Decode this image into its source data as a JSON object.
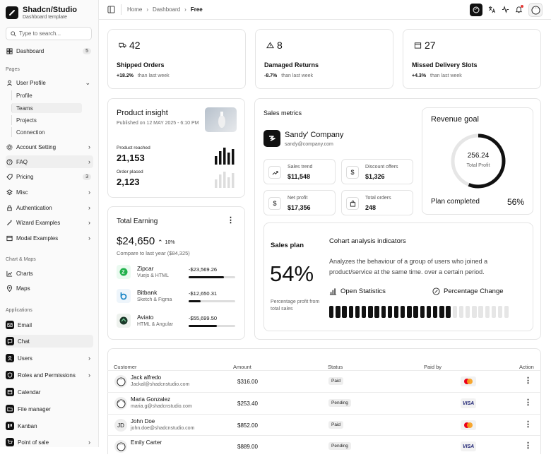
{
  "brand": {
    "title": "Shadcn/Studio",
    "subtitle": "Dashboard template"
  },
  "search": {
    "placeholder": "Type to search..."
  },
  "sidebar": {
    "dashboard": {
      "label": "Dashboard",
      "badge": "5"
    },
    "pages_section": "Pages",
    "user_profile": "User Profile",
    "sub": [
      "Profile",
      "Teams",
      "Projects",
      "Connection"
    ],
    "items": [
      {
        "label": "Account Setting"
      },
      {
        "label": "FAQ"
      },
      {
        "label": "Pricing",
        "badge": "3"
      },
      {
        "label": "Misc"
      },
      {
        "label": "Authentication"
      },
      {
        "label": "Wizard Examples"
      },
      {
        "label": "Modal Examples"
      }
    ],
    "charts_section": "Chart & Maps",
    "charts": "Charts",
    "maps": "Maps",
    "apps_section": "Applications",
    "apps": [
      "Email",
      "Chat",
      "Users",
      "Roles and Permissions",
      "Calendar",
      "File manager",
      "Kanban",
      "Point of sale"
    ]
  },
  "breadcrumb": {
    "home": "Home",
    "dashboard": "Dashboard",
    "current": "Free"
  },
  "stats": [
    {
      "value": "42",
      "label": "Shipped Orders",
      "delta": "+18.2%",
      "note": "than last week"
    },
    {
      "value": "8",
      "label": "Damaged Returns",
      "delta": "-8.7%",
      "note": "than last week"
    },
    {
      "value": "27",
      "label": "Missed Delivery Slots",
      "delta": "+4.3%",
      "note": "than last week"
    }
  ],
  "insight": {
    "title": "Product insight",
    "published": "Published on 12 MAY 2025 - 6:10 PM",
    "reached_label": "Product reached",
    "reached_value": "21,153",
    "placed_label": "Order placed",
    "placed_value": "2,123"
  },
  "earning": {
    "title": "Total Earning",
    "amount": "$24,650",
    "change": "10%",
    "compare": "Compare to last year ($84,325)",
    "items": [
      {
        "name": "Zipcar",
        "sub": "Vuejs & HTML",
        "amount": "-$23,569.26",
        "progress": 0.75
      },
      {
        "name": "Bitbank",
        "sub": "Sketch & Figma",
        "amount": "-$12,650.31",
        "progress": 0.25
      },
      {
        "name": "Aviato",
        "sub": "HTML & Angular",
        "amount": "-$55,699.50",
        "progress": 0.6
      }
    ]
  },
  "sales": {
    "title": "Sales metrics",
    "company": "Sandy' Company",
    "email": "sandy@company.com",
    "metrics": [
      {
        "label": "Sales trend",
        "value": "$11,548",
        "icon": "trend-icon"
      },
      {
        "label": "Discount offers",
        "value": "$1,326",
        "icon": "dollar-icon"
      },
      {
        "label": "Net profit",
        "value": "$17,356",
        "icon": "dollar-icon"
      },
      {
        "label": "Total orders",
        "value": "248",
        "icon": "bag-icon"
      }
    ]
  },
  "revenue": {
    "title": "Revenue goal",
    "value": "256.24",
    "value_label": "Total Profit",
    "plan_label": "Plan completed",
    "plan_value": "56%",
    "progress": 0.56
  },
  "plan": {
    "title": "Sales plan",
    "percent": "54%",
    "caption": "Percentage profit from total sales",
    "cohort_title": "Cohart analysis indicators",
    "cohort_desc": "Analyzes the behaviour of a group of users who joined a product/service at the same time. over a certain period.",
    "open_stats": "Open Statistics",
    "pct_change": "Percentage Change",
    "filled_bars": 19,
    "total_bars": 28
  },
  "table": {
    "headers": [
      "Customer",
      "Amount",
      "Status",
      "Paid by",
      "Action"
    ],
    "rows": [
      {
        "name": "Jack alfredo",
        "email": "Jackal@shadcnstudio.com",
        "amount": "$316.00",
        "status": "Paid",
        "pay": "mastercard",
        "avatar": ""
      },
      {
        "name": "Maria Gonzalez",
        "email": "maria.g@shadcnstudio.com",
        "amount": "$253.40",
        "status": "Pending",
        "pay": "visa",
        "avatar": ""
      },
      {
        "name": "John Doe",
        "email": "john.doe@shadcnstudio.com",
        "amount": "$852.00",
        "status": "Paid",
        "pay": "mastercard",
        "avatar": "JD"
      },
      {
        "name": "Emily Carter",
        "email": "",
        "amount": "$889.00",
        "status": "Pending",
        "pay": "visa",
        "avatar": ""
      }
    ],
    "visa": "VISA"
  }
}
